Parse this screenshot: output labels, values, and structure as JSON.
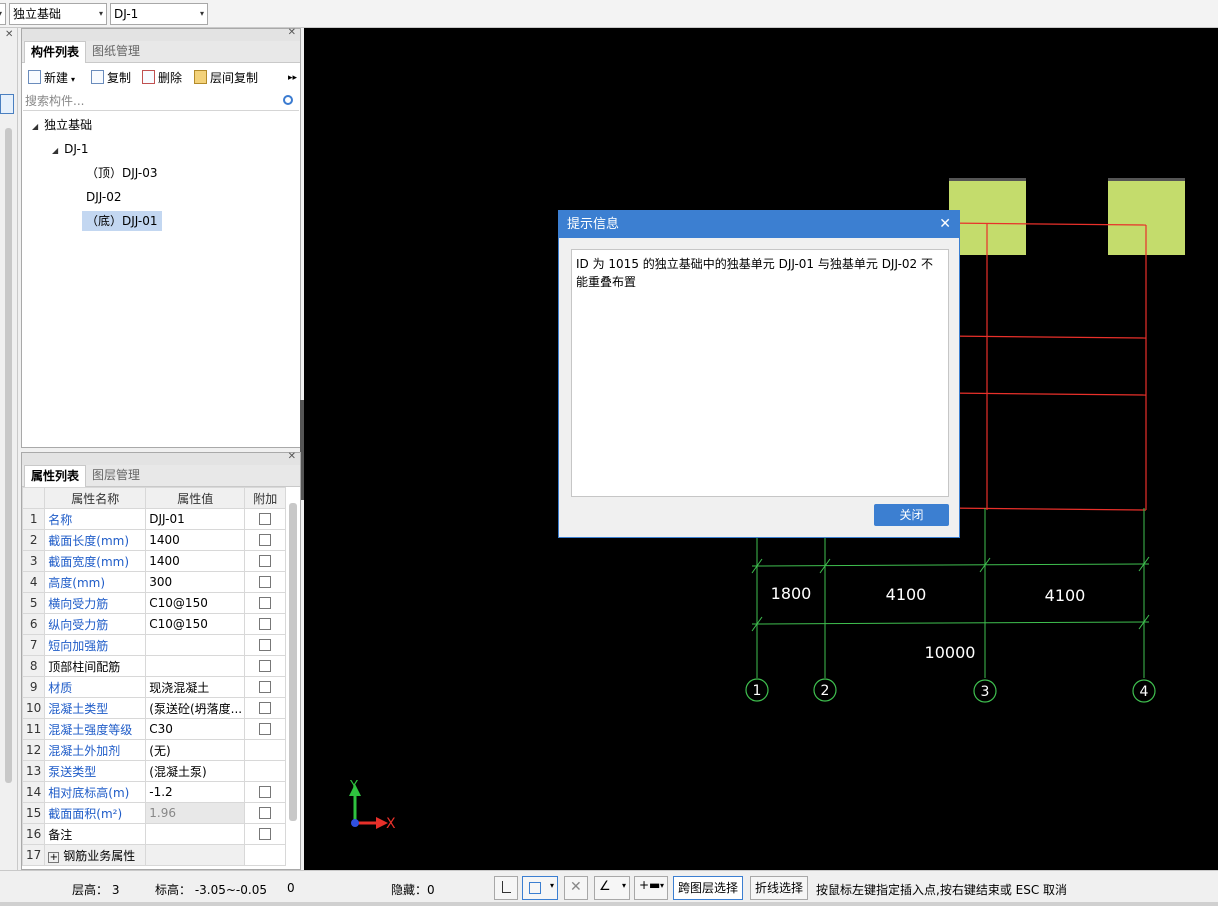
{
  "toolbar": {
    "category_value": "独立基础",
    "element_value": "DJ-1"
  },
  "component_panel": {
    "tab_active": "构件列表",
    "tab_other": "图纸管理",
    "actions": {
      "new": "新建",
      "copy": "复制",
      "delete": "删除",
      "floor_copy": "层间复制"
    },
    "search_placeholder": "搜索构件...",
    "tree": {
      "root": "独立基础",
      "child": "DJ-1",
      "items": [
        "（顶）DJJ-03",
        "DJJ-02",
        "（底）DJJ-01"
      ]
    }
  },
  "property_panel": {
    "tab_active": "属性列表",
    "tab_other": "图层管理",
    "headers": {
      "name": "属性名称",
      "value": "属性值",
      "extra": "附加"
    },
    "rows": [
      {
        "n": "1",
        "name": "名称",
        "value": "DJJ-01"
      },
      {
        "n": "2",
        "name": "截面长度(mm)",
        "value": "1400"
      },
      {
        "n": "3",
        "name": "截面宽度(mm)",
        "value": "1400"
      },
      {
        "n": "4",
        "name": "高度(mm)",
        "value": "300"
      },
      {
        "n": "5",
        "name": "横向受力筋",
        "value": "C10@150"
      },
      {
        "n": "6",
        "name": "纵向受力筋",
        "value": "C10@150"
      },
      {
        "n": "7",
        "name": "短向加强筋",
        "value": ""
      },
      {
        "n": "8",
        "name": "顶部柱间配筋",
        "value": ""
      },
      {
        "n": "9",
        "name": "材质",
        "value": "现浇混凝土"
      },
      {
        "n": "10",
        "name": "混凝土类型",
        "value": "(泵送砼(坍落度..."
      },
      {
        "n": "11",
        "name": "混凝土强度等级",
        "value": "C30"
      },
      {
        "n": "12",
        "name": "混凝土外加剂",
        "value": "(无)"
      },
      {
        "n": "13",
        "name": "泵送类型",
        "value": "(混凝土泵)"
      },
      {
        "n": "14",
        "name": "相对底标高(m)",
        "value": "-1.2"
      },
      {
        "n": "15",
        "name": "截面面积(m²)",
        "value": "1.96"
      },
      {
        "n": "16",
        "name": "备注",
        "value": ""
      },
      {
        "n": "17",
        "name": "钢筋业务属性",
        "value": ""
      }
    ]
  },
  "canvas": {
    "dims": [
      "1800",
      "4100",
      "4100",
      "10000"
    ],
    "axes": [
      "1",
      "2",
      "3",
      "4"
    ],
    "axis_x": "X",
    "axis_y": "Y",
    "colors": {
      "background": "#000000",
      "block": "#c4dc6c",
      "beam": "#e8302a",
      "grid": "#3fbf4f"
    }
  },
  "dialog": {
    "title": "提示信息",
    "message": "ID 为 1015 的独立基础中的独基单元 DJJ-01 与独基单元 DJJ-02 不能重叠布置",
    "button": "关闭"
  },
  "statusbar": {
    "floor_height": "层高： 3",
    "elevation": "标高： -3.05~-0.05",
    "zero": "0",
    "hidden": "隐藏：0",
    "cross_layer": "跨图层选择",
    "polyline": "折线选择",
    "hint": "按鼠标左键指定插入点,按右键结束或 ESC 取消"
  }
}
